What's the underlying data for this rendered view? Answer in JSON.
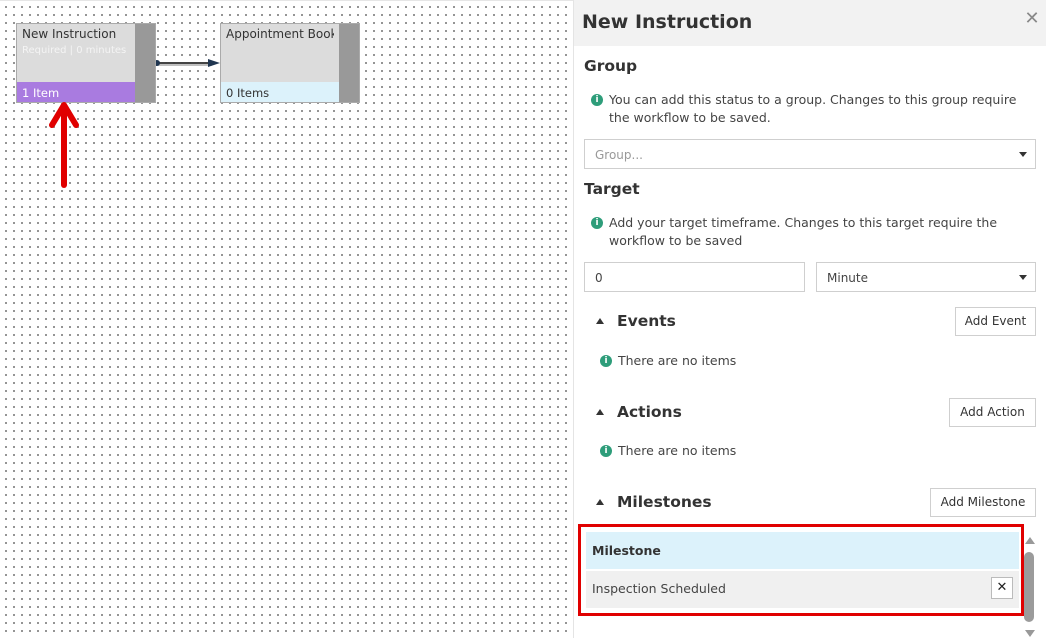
{
  "canvas": {
    "nodes": [
      {
        "title": "New Instruction",
        "subtitle": "Required | 0 minutes",
        "footer": "1 Item"
      },
      {
        "title": "Appointment Booked",
        "footer": "0 Items"
      }
    ],
    "colors": {
      "selected_footer": "#a97be0",
      "node_footer": "#dcf2fb",
      "annotation_arrow": "#e00000"
    }
  },
  "panel": {
    "title": "New Instruction",
    "close_icon": "close-icon",
    "group": {
      "title": "Group",
      "info": "You can add this status to a group. Changes to this group require the workflow to be saved.",
      "placeholder": "Group..."
    },
    "target": {
      "title": "Target",
      "info": "Add your target timeframe. Changes to this target require the workflow to be saved",
      "value": "0",
      "unit": "Minute"
    },
    "events": {
      "title": "Events",
      "button": "Add Event",
      "empty": "There are no items"
    },
    "actions": {
      "title": "Actions",
      "button": "Add Action",
      "empty": "There are no items"
    },
    "milestones": {
      "title": "Milestones",
      "button": "Add Milestone",
      "table_header": "Milestone",
      "items": [
        {
          "name": "Inspection Scheduled",
          "remove_icon": "close-icon"
        }
      ]
    },
    "colors": {
      "info_icon": "#2e9d7a",
      "highlight_border": "#e00000",
      "table_header_bg": "#dcf2fb"
    }
  }
}
